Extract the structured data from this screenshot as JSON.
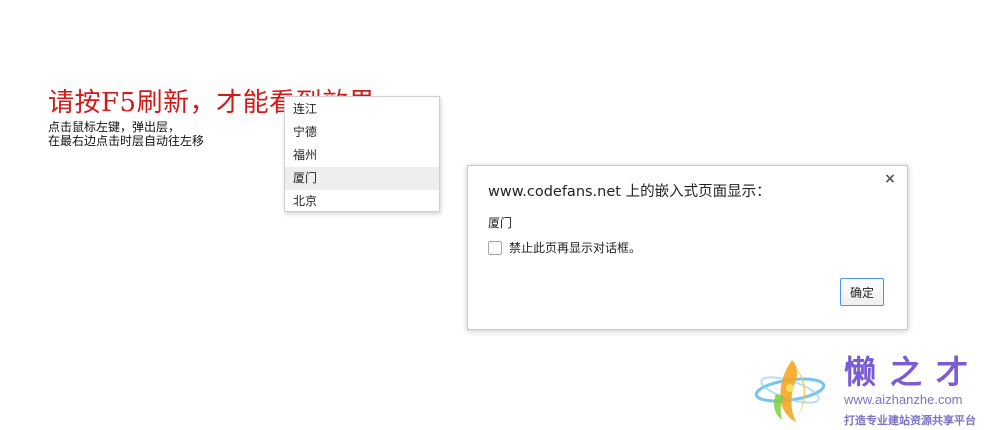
{
  "page": {
    "headline": "请按F5刷新，才能看到效果",
    "instructions": [
      "点击鼠标左键，弹出层，",
      "在最右边点击时层自动往左移"
    ]
  },
  "popup_menu": {
    "items": [
      {
        "label": "连江"
      },
      {
        "label": "宁德"
      },
      {
        "label": "福州"
      },
      {
        "label": "厦门",
        "hovered": true
      },
      {
        "label": "北京"
      }
    ]
  },
  "dialog": {
    "title": "www.codefans.net 上的嵌入式页面显示：",
    "message": "厦门",
    "checkbox_label": "禁止此页再显示对话框。",
    "checkbox_checked": false,
    "ok_label": "确定",
    "close_glyph": "×",
    "accent_color": "#4d90fe"
  },
  "watermark": {
    "brand": "懒之才",
    "url": "www.aizhanzhe.com",
    "slogan": "打造专业建站资源共享平台"
  },
  "colors": {
    "headline": "#d21a1a",
    "watermark": "#7b5cd6"
  }
}
